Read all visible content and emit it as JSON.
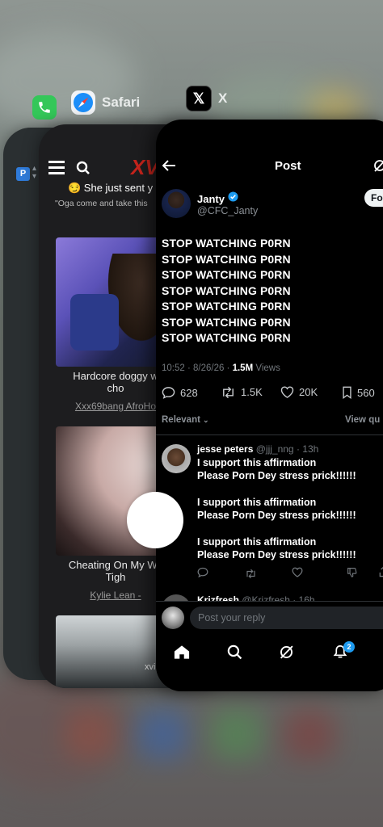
{
  "switcher": {
    "safari_label": "Safari",
    "x_label": "X"
  },
  "safari": {
    "notification": "😏 She just sent y",
    "notification_sub": "\"Oga come and take this",
    "logo_partial": "XV",
    "videos": [
      {
        "title_line1": "Hardcore doggy w",
        "title_line2": "cho",
        "source": "Xxx69bang AfroHo"
      },
      {
        "title_line1": "Cheating On My Wif",
        "title_line2": "Tigh",
        "source": "Kylie Lean -"
      },
      {
        "watermark": "xvi"
      }
    ]
  },
  "x_app": {
    "header_title": "Post",
    "author": {
      "name": "Janty",
      "handle": "@CFC_Janty",
      "follow_label": "Fo"
    },
    "post_lines": [
      "STOP WATCHING P0RN",
      "STOP WATCHING P0RN",
      "STOP WATCHING P0RN",
      "STOP WATCHING P0RN",
      "STOP WATCHING P0RN",
      "STOP WATCHING P0RN",
      "STOP WATCHING P0RN"
    ],
    "meta": {
      "timestamp": "10:52 · 8/26/26 · ",
      "views_count": "1.5M",
      "views_label": " Views"
    },
    "stats": {
      "replies": "628",
      "reposts": "1.5K",
      "likes": "20K",
      "bookmarks": "560"
    },
    "sort_label": "Relevant",
    "view_quotes_label": "View qu",
    "reply": {
      "name": "jesse peters",
      "handle": "@jjj_nng",
      "time": " · 13h",
      "lines": [
        "I support this affirmation",
        "Please Porn Dey stress prick!!!!!!",
        "I support this affirmation",
        "Please Porn Dey stress prick!!!!!!",
        "I support this affirmation",
        "Please Porn Dey stress prick!!!!!!"
      ]
    },
    "next_reply": {
      "name": "Krizfresh",
      "handle": "@Krizfresh",
      "time": " · 16h"
    },
    "reply_placeholder": "Post your reply",
    "notification_badge": "2"
  },
  "colors": {
    "x_blue": "#1d9bf0",
    "verified": "#1d9bf0",
    "safari_logo_red": "#c8241c",
    "p_app_blue": "#2f7bd9"
  }
}
